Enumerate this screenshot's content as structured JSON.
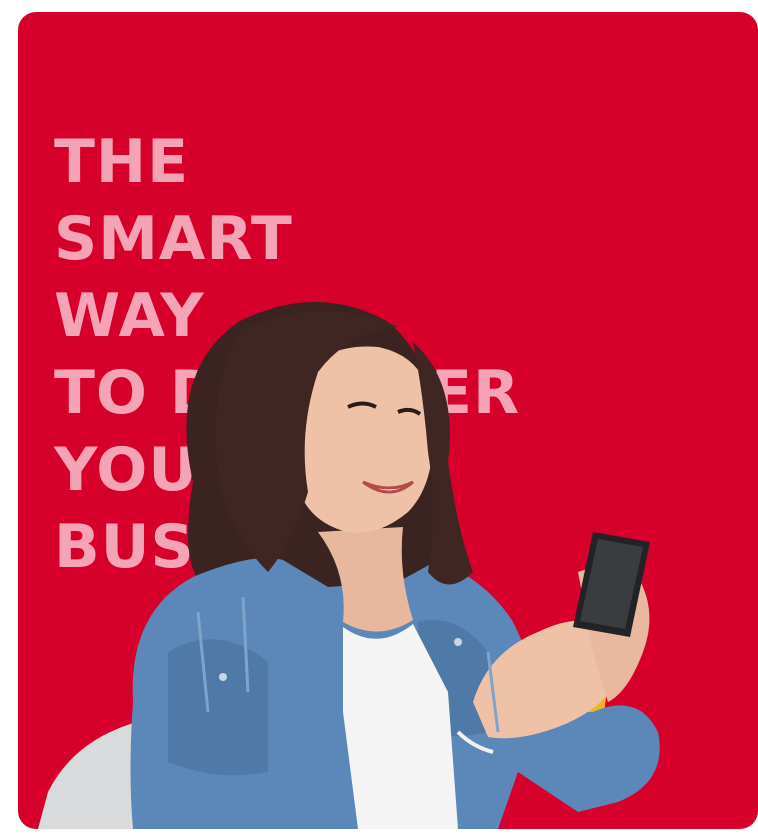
{
  "promo": {
    "headline_lines": [
      "THE",
      "SMART",
      "WAY",
      "TO DISCOVER",
      "YOUR",
      "BUSINESS"
    ]
  },
  "colors": {
    "card_background": "#d6002a",
    "headline_text": "#f5a3b7"
  },
  "image": {
    "subject": "woman-smiling-using-smartphone",
    "accessory": "yellow-card"
  }
}
